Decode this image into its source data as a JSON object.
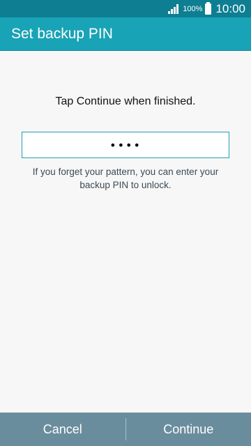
{
  "status_bar": {
    "battery_percent": "100%",
    "time": "10:00",
    "signal_icon": "signal-bars-icon",
    "battery_icon": "battery-full-icon"
  },
  "action_bar": {
    "title": "Set backup PIN"
  },
  "main": {
    "instruction": "Tap Continue when finished.",
    "pin_value": "••••",
    "hint": "If you forget your pattern, you can enter your backup PIN to unlock."
  },
  "bottom_bar": {
    "cancel_label": "Cancel",
    "continue_label": "Continue"
  },
  "colors": {
    "status_bar": "#0e7e92",
    "action_bar": "#19a3b6",
    "bottom_bar": "#6a8d9d",
    "input_border": "#1fa0b4"
  }
}
